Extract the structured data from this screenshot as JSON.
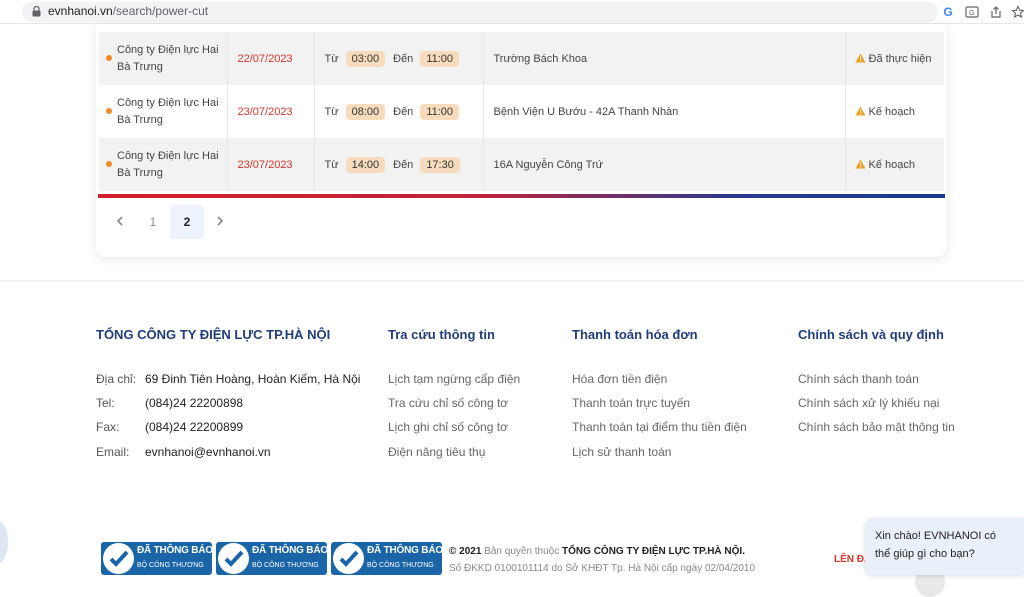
{
  "browser": {
    "url_domain": "evnhanoi.vn",
    "url_path": "/search/power-cut"
  },
  "outages": {
    "from_label": "Từ",
    "to_label": "Đến",
    "rows": [
      {
        "unit": "Công ty Điện lực Hai Bà Trưng",
        "date": "22/07/2023",
        "start": "03:00",
        "end": "11:00",
        "location": "Trường Bách Khoa",
        "status": "Đã thực hiện"
      },
      {
        "unit": "Công ty Điện lực Hai Bà Trưng",
        "date": "23/07/2023",
        "start": "08:00",
        "end": "11:00",
        "location": "Bệnh Viện U Bướu - 42A Thanh Nhàn",
        "status": "Kế hoạch"
      },
      {
        "unit": "Công ty Điện lực Hai Bà Trưng",
        "date": "23/07/2023",
        "start": "14:00",
        "end": "17:30",
        "location": "16A Nguyễn Công Trứ",
        "status": "Kế hoạch"
      }
    ]
  },
  "pagination": {
    "prev_icon": "chevron-left-icon",
    "next_icon": "chevron-right-icon",
    "pages": [
      "1",
      "2"
    ],
    "current_page": "2"
  },
  "footer": {
    "company": {
      "title": "TỔNG CÔNG TY ĐIỆN LỰC TP.HÀ NỘI",
      "address_label": "Địa chỉ:",
      "address": "69 Đinh Tiên Hoàng, Hoàn Kiếm, Hà Nội",
      "tel_label": "Tel:",
      "tel": "(084)24 22200898",
      "fax_label": "Fax:",
      "fax": "(084)24 22200899",
      "email_label": "Email:",
      "email": "evnhanoi@evnhanoi.vn"
    },
    "lookup": {
      "title": "Tra cứu thông tin",
      "links": [
        "Lịch tạm ngừng cấp điện",
        "Tra cứu chỉ số công tơ",
        "Lịch ghi chỉ số công tơ",
        "Điện năng tiêu thụ"
      ]
    },
    "billing": {
      "title": "Thanh toán hóa đơn",
      "links": [
        "Hóa đơn tiền điện",
        "Thanh toán trực tuyến",
        "Thanh toán tại điểm thu tiền điện",
        "Lịch sử thanh toán"
      ]
    },
    "policy": {
      "title": "Chính sách và quy định",
      "links": [
        "Chính sách thanh toán",
        "Chính sách xử lý khiếu nại",
        "Chính sách bảo mật thông tin"
      ]
    },
    "badges": [
      {
        "line1": "ĐÃ THÔNG BÁO",
        "line2": "BỘ CÔNG THƯƠNG"
      },
      {
        "line1": "ĐÃ THÔNG BÁO",
        "line2": "BỘ CÔNG THƯƠNG"
      },
      {
        "line1": "ĐÃ THÔNG BÁO",
        "line2": "BỘ CÔNG THƯƠNG"
      }
    ],
    "copyright_prefix": "© 2021",
    "copyright_text": "Bản quyền thuộc",
    "copyright_owner": "TỔNG CÔNG TY ĐIỆN LỰC TP.HÀ NỘI.",
    "registration": "Số ĐKKD 0100101114 do Sở KHĐT Tp. Hà Nội cấp ngày 02/04/2010",
    "back_to_top": "LÊN ĐẦ"
  },
  "chat": {
    "greeting": "Xin chào! EVNHANOI có thể giúp gì cho bạn?"
  },
  "colors": {
    "accent_blue": "#1f3d7a",
    "date_red": "#d9342b",
    "time_chip": "#f6dcbc",
    "warning_orange": "#f0a020",
    "dot_orange": "#f08a24"
  }
}
